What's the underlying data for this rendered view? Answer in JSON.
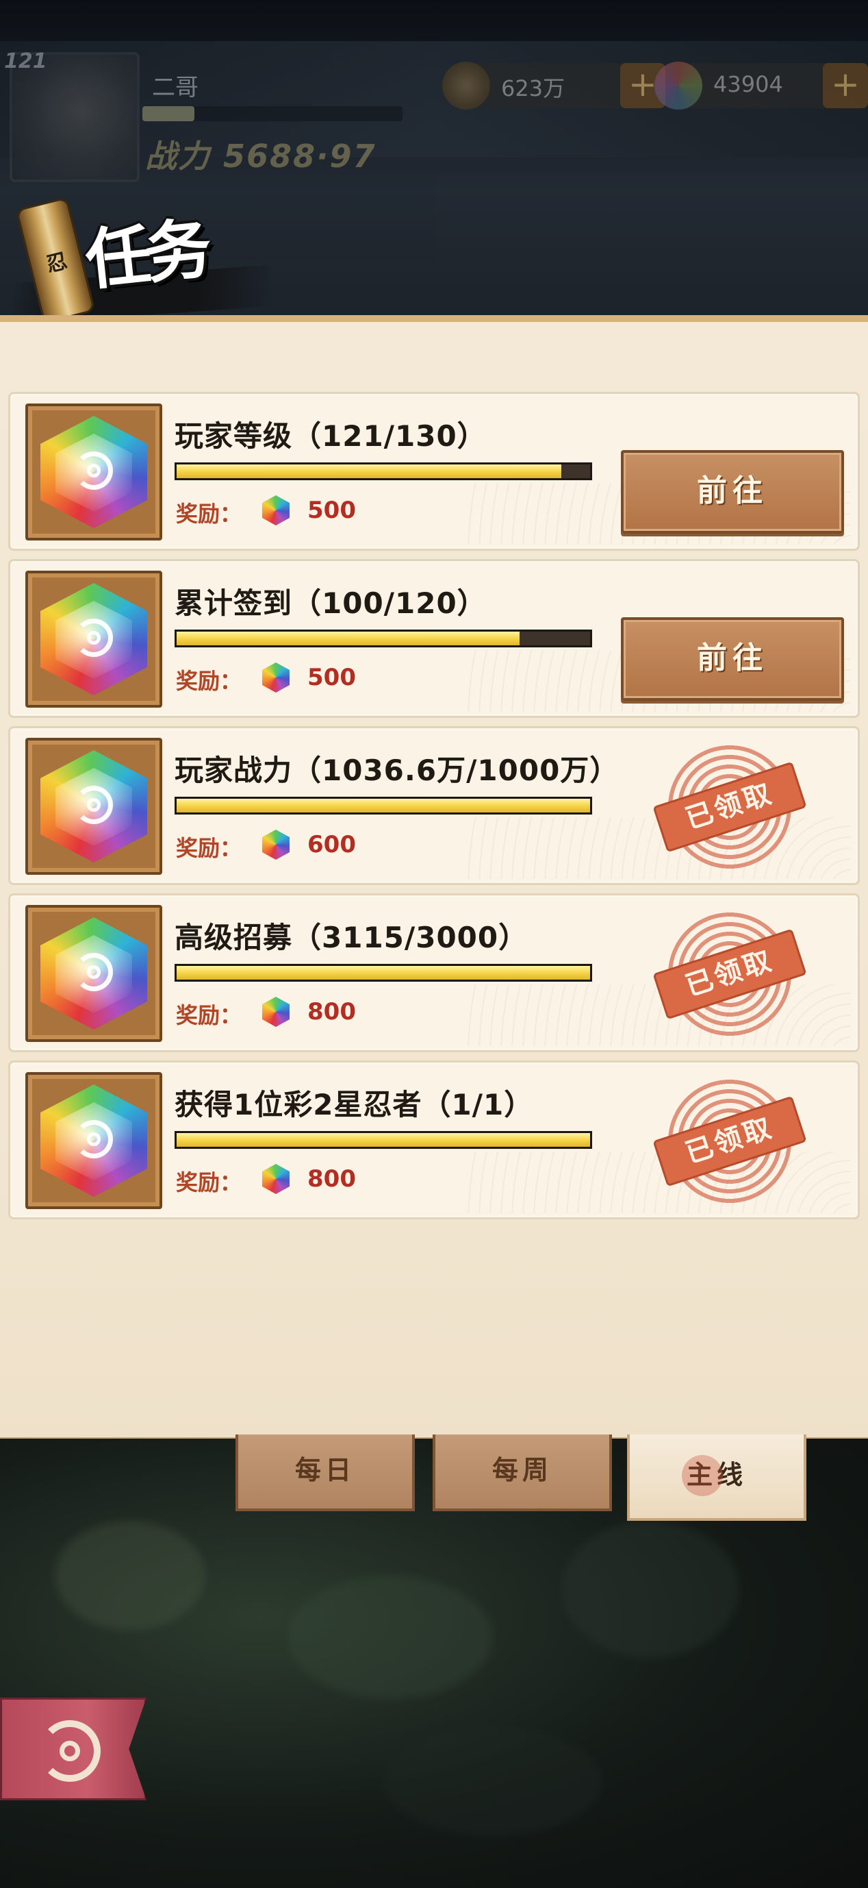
{
  "header": {
    "level": "121",
    "player_name": "二哥",
    "power_text": "战力 5688·97",
    "currency": [
      {
        "icon": "coin-icon",
        "value": "623万"
      },
      {
        "icon": "gem-icon",
        "value": "43904"
      }
    ],
    "plus_label": "+"
  },
  "title": {
    "scroll_glyph": "忍",
    "text": "任务"
  },
  "tasks": [
    {
      "title": "玩家等级（121/130）",
      "progress": 0.93,
      "reward_label": "奖励：",
      "reward_value": "500",
      "status": "go",
      "button_label": "前往"
    },
    {
      "title": "累计签到（100/120）",
      "progress": 0.83,
      "reward_label": "奖励：",
      "reward_value": "500",
      "status": "go",
      "button_label": "前往"
    },
    {
      "title": "玩家战力（1036.6万/1000万）",
      "progress": 1.0,
      "reward_label": "奖励：",
      "reward_value": "600",
      "status": "claimed",
      "stamp_label": "已领取"
    },
    {
      "title": "高级招募（3115/3000）",
      "progress": 1.0,
      "reward_label": "奖励：",
      "reward_value": "800",
      "status": "claimed",
      "stamp_label": "已领取"
    },
    {
      "title": "获得1位彩2星忍者（1/1）",
      "progress": 1.0,
      "reward_label": "奖励：",
      "reward_value": "800",
      "status": "claimed",
      "stamp_label": "已领取"
    }
  ],
  "tabs": [
    {
      "label": "每日",
      "active": false
    },
    {
      "label": "每周",
      "active": false
    },
    {
      "label": "主线",
      "active": true
    }
  ],
  "colors": {
    "panel": "#f3e9d6",
    "progress_fill": "#f6d54c",
    "reward_text": "#b32d23",
    "button": "#b27446",
    "stamp": "#d96a45"
  },
  "icons": {
    "task_icon": "rainbow-gem-icon",
    "back": "back-swirl-icon"
  }
}
